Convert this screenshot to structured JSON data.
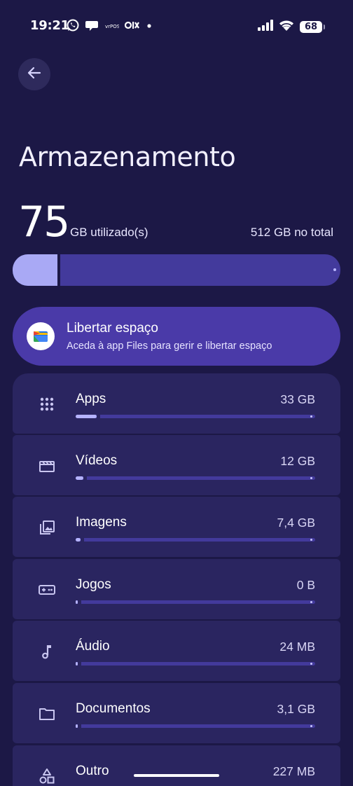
{
  "status_bar": {
    "time": "19:21",
    "notif_icons": [
      "whatsapp-icon",
      "chat-bubble-icon",
      "app-icon",
      "olx-icon",
      "dot-icon"
    ],
    "battery": "68"
  },
  "header": {
    "title": "Armazenamento"
  },
  "summary": {
    "used_value": "75",
    "used_label": "GB utilizado(s)",
    "total_label": "512 GB no total",
    "used_fraction": 0.146,
    "accent_color": "#a9a9f5"
  },
  "free_up": {
    "title": "Libertar espaço",
    "subtitle": "Aceda à app Files para gerir e libertar espaço",
    "icon": "files-app-icon"
  },
  "categories": [
    {
      "name": "Apps",
      "size": "33 GB",
      "fraction": 0.064,
      "icon": "apps-grid-icon"
    },
    {
      "name": "Vídeos",
      "size": "12 GB",
      "fraction": 0.023,
      "icon": "video-clapper-icon"
    },
    {
      "name": "Imagens",
      "size": "7,4 GB",
      "fraction": 0.014,
      "icon": "images-icon"
    },
    {
      "name": "Jogos",
      "size": "0 B",
      "fraction": 0.0,
      "icon": "gamepad-icon"
    },
    {
      "name": "Áudio",
      "size": "24 MB",
      "fraction": 0.0,
      "icon": "music-note-icon"
    },
    {
      "name": "Documentos",
      "size": "3,1 GB",
      "fraction": 0.006,
      "icon": "folder-icon"
    },
    {
      "name": "Outro",
      "size": "227 MB",
      "fraction": 0.0,
      "icon": "shapes-icon"
    }
  ]
}
